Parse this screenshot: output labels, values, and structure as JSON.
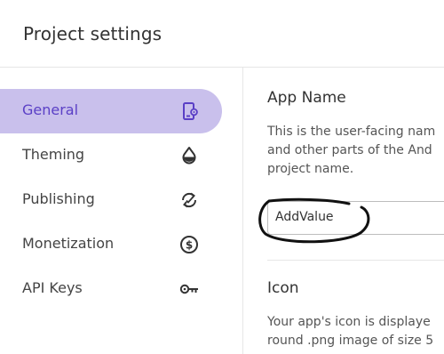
{
  "header": {
    "title": "Project settings"
  },
  "sidebar": {
    "items": [
      {
        "label": "General",
        "icon": "app-settings-icon",
        "active": true
      },
      {
        "label": "Theming",
        "icon": "water-drop-icon",
        "active": false
      },
      {
        "label": "Publishing",
        "icon": "sync-icon",
        "active": false
      },
      {
        "label": "Monetization",
        "icon": "dollar-circle-icon",
        "active": false
      },
      {
        "label": "API Keys",
        "icon": "key-icon",
        "active": false
      }
    ]
  },
  "main": {
    "app_name": {
      "title": "App Name",
      "desc_lines": [
        "This is the user-facing nam",
        "and other parts of the And",
        "project name."
      ],
      "input_value": "AddValue"
    },
    "icon_section": {
      "title": "Icon",
      "desc_lines": [
        "Your app's icon is displaye",
        "round .png image of size 5"
      ]
    }
  },
  "colors": {
    "active_bg": "#c9c0ec",
    "active_text": "#5a3fc6",
    "annotation": "#111111"
  }
}
